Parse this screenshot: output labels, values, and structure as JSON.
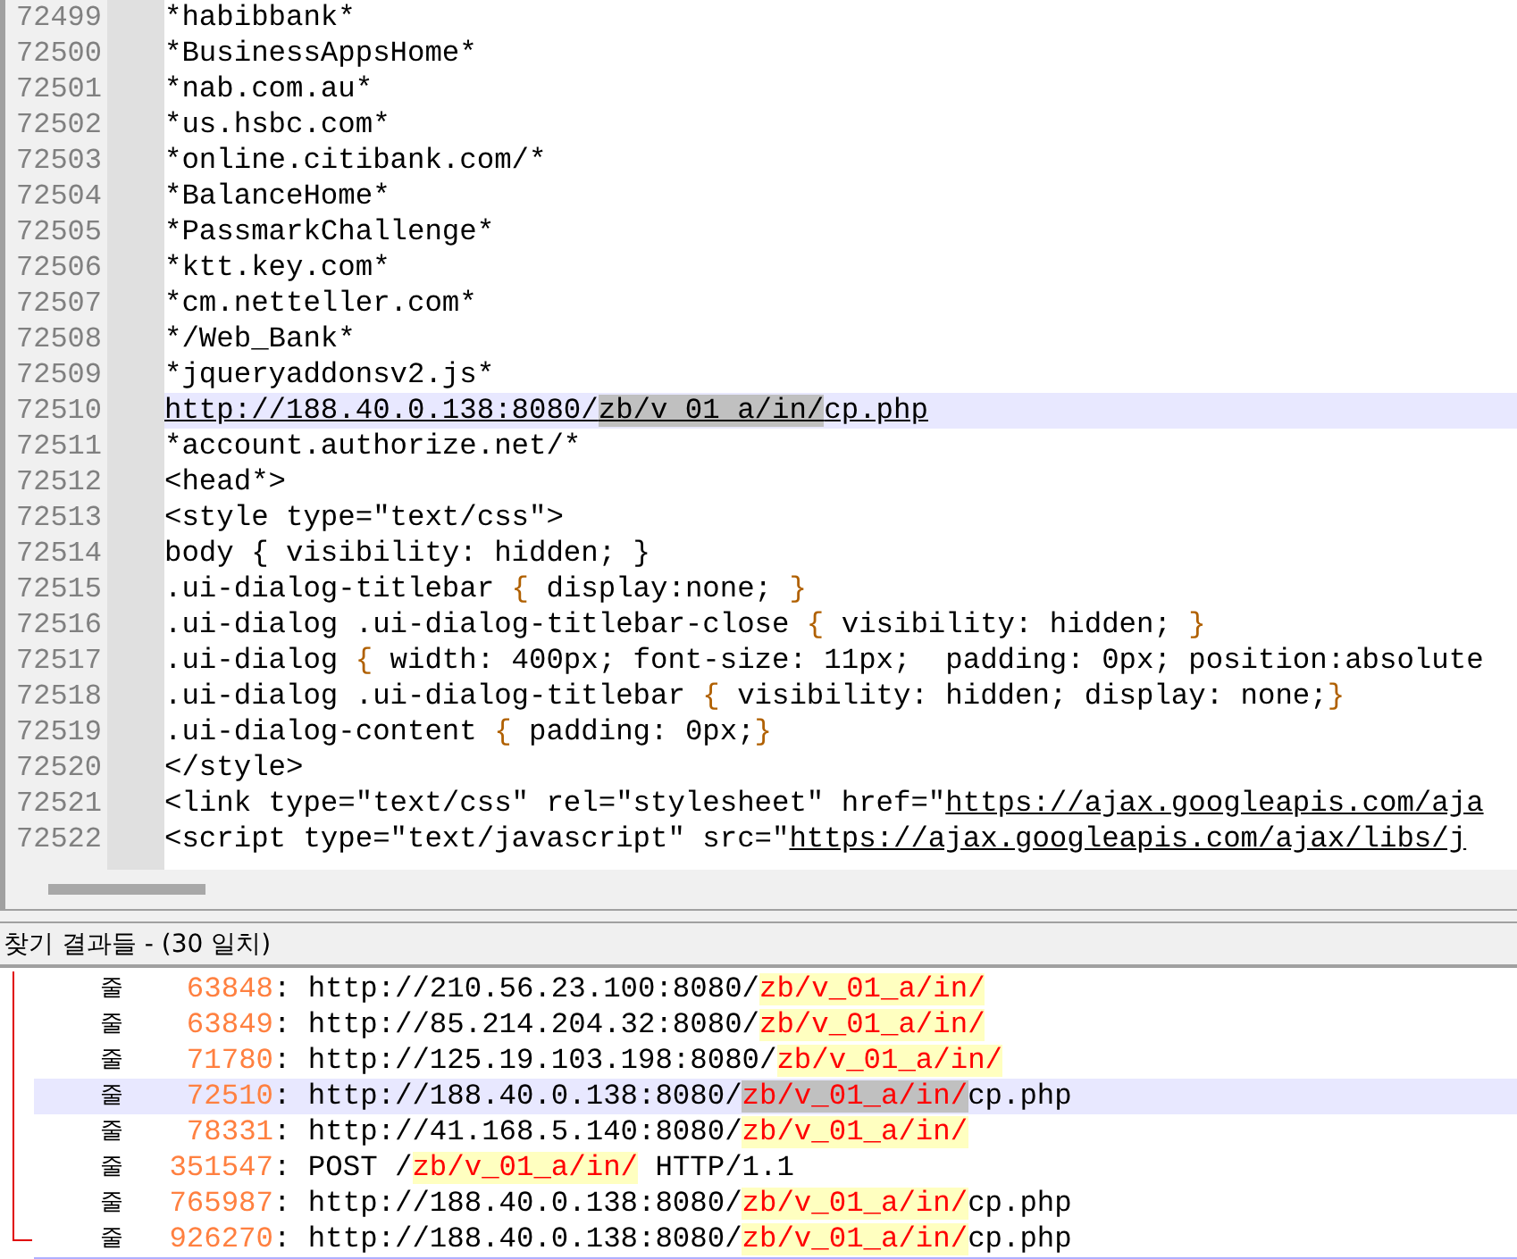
{
  "editor": {
    "lines": [
      {
        "number": "72499",
        "selected": false,
        "segments": [
          {
            "text": "*habibbank*",
            "kind": "plain"
          }
        ]
      },
      {
        "number": "72500",
        "selected": false,
        "segments": [
          {
            "text": "*BusinessAppsHome*",
            "kind": "plain"
          }
        ]
      },
      {
        "number": "72501",
        "selected": false,
        "segments": [
          {
            "text": "*nab.com.au*",
            "kind": "plain"
          }
        ]
      },
      {
        "number": "72502",
        "selected": false,
        "segments": [
          {
            "text": "*us.hsbc.com*",
            "kind": "plain"
          }
        ]
      },
      {
        "number": "72503",
        "selected": false,
        "segments": [
          {
            "text": "*online.citibank.com/*",
            "kind": "plain"
          }
        ]
      },
      {
        "number": "72504",
        "selected": false,
        "segments": [
          {
            "text": "*BalanceHome*",
            "kind": "plain"
          }
        ]
      },
      {
        "number": "72505",
        "selected": false,
        "segments": [
          {
            "text": "*PassmarkChallenge*",
            "kind": "plain"
          }
        ]
      },
      {
        "number": "72506",
        "selected": false,
        "segments": [
          {
            "text": "*ktt.key.com*",
            "kind": "plain"
          }
        ]
      },
      {
        "number": "72507",
        "selected": false,
        "segments": [
          {
            "text": "*cm.netteller.com*",
            "kind": "plain"
          }
        ]
      },
      {
        "number": "72508",
        "selected": false,
        "segments": [
          {
            "text": "*/Web_Bank*",
            "kind": "plain"
          }
        ]
      },
      {
        "number": "72509",
        "selected": false,
        "segments": [
          {
            "text": "*jqueryaddonsv2.js*",
            "kind": "plain"
          }
        ]
      },
      {
        "number": "72510",
        "selected": true,
        "segments": [
          {
            "text": "http://188.40.0.138:8080/",
            "kind": "link"
          },
          {
            "text": "zb/v_01_a/in/",
            "kind": "found"
          },
          {
            "text": "cp.php",
            "kind": "link"
          }
        ]
      },
      {
        "number": "72511",
        "selected": false,
        "segments": [
          {
            "text": "*account.authorize.net/*",
            "kind": "plain"
          }
        ]
      },
      {
        "number": "72512",
        "selected": false,
        "segments": [
          {
            "text": "<head*>",
            "kind": "plain"
          }
        ]
      },
      {
        "number": "72513",
        "selected": false,
        "segments": [
          {
            "text": "<style type=\"text/css\">",
            "kind": "plain"
          }
        ]
      },
      {
        "number": "72514",
        "selected": false,
        "segments": [
          {
            "text": "body { visibility: hidden; }",
            "kind": "plain"
          }
        ]
      },
      {
        "number": "72515",
        "selected": false,
        "segments": [
          {
            "text": ".ui-dialog-titlebar ",
            "kind": "plain"
          },
          {
            "text": "{",
            "kind": "brace"
          },
          {
            "text": " display:none; ",
            "kind": "plain"
          },
          {
            "text": "}",
            "kind": "brace"
          }
        ]
      },
      {
        "number": "72516",
        "selected": false,
        "segments": [
          {
            "text": ".ui-dialog .ui-dialog-titlebar-close ",
            "kind": "plain"
          },
          {
            "text": "{",
            "kind": "brace"
          },
          {
            "text": " visibility: hidden; ",
            "kind": "plain"
          },
          {
            "text": "}",
            "kind": "brace"
          }
        ]
      },
      {
        "number": "72517",
        "selected": false,
        "segments": [
          {
            "text": ".ui-dialog ",
            "kind": "plain"
          },
          {
            "text": "{",
            "kind": "brace"
          },
          {
            "text": " width: 400px; font-size: 11px;  padding: 0px; position:absolute",
            "kind": "plain"
          }
        ]
      },
      {
        "number": "72518",
        "selected": false,
        "segments": [
          {
            "text": ".ui-dialog .ui-dialog-titlebar ",
            "kind": "plain"
          },
          {
            "text": "{",
            "kind": "brace"
          },
          {
            "text": " visibility: hidden; display: none;",
            "kind": "plain"
          },
          {
            "text": "}",
            "kind": "brace"
          }
        ]
      },
      {
        "number": "72519",
        "selected": false,
        "segments": [
          {
            "text": ".ui-dialog-content ",
            "kind": "plain"
          },
          {
            "text": "{",
            "kind": "brace"
          },
          {
            "text": " padding: 0px;",
            "kind": "plain"
          },
          {
            "text": "}",
            "kind": "brace"
          }
        ]
      },
      {
        "number": "72520",
        "selected": false,
        "segments": [
          {
            "text": "</style>",
            "kind": "plain"
          }
        ]
      },
      {
        "number": "72521",
        "selected": false,
        "segments": [
          {
            "text": "<link type=\"text/css\" rel=\"stylesheet\" href=\"",
            "kind": "plain"
          },
          {
            "text": "https://ajax.googleapis.com/aja",
            "kind": "link"
          }
        ]
      },
      {
        "number": "72522",
        "selected": false,
        "segments": [
          {
            "text": "<script type=\"text/javascript\" src=\"",
            "kind": "plain"
          },
          {
            "text": "https://ajax.googleapis.com/ajax/libs/j",
            "kind": "link"
          }
        ]
      }
    ]
  },
  "results": {
    "title": "찾기 결과들 - (30 일치)",
    "rows": [
      {
        "label": "줄",
        "line": "63848",
        "selected": false,
        "parts": [
          {
            "text": ": http://210.56.23.100:8080/",
            "kind": "plain"
          },
          {
            "text": "zb/v_01_a/in/",
            "kind": "match"
          }
        ]
      },
      {
        "label": "줄",
        "line": "63849",
        "selected": false,
        "parts": [
          {
            "text": ": http://85.214.204.32:8080/",
            "kind": "plain"
          },
          {
            "text": "zb/v_01_a/in/",
            "kind": "match"
          }
        ]
      },
      {
        "label": "줄",
        "line": "71780",
        "selected": false,
        "parts": [
          {
            "text": ": http://125.19.103.198:8080/",
            "kind": "plain"
          },
          {
            "text": "zb/v_01_a/in/",
            "kind": "match"
          }
        ]
      },
      {
        "label": "줄",
        "line": "72510",
        "selected": true,
        "parts": [
          {
            "text": ": http://188.40.0.138:8080/",
            "kind": "plain"
          },
          {
            "text": "zb/v_01_a/in/",
            "kind": "match"
          },
          {
            "text": "cp.php",
            "kind": "plain"
          }
        ]
      },
      {
        "label": "줄",
        "line": "78331",
        "selected": false,
        "parts": [
          {
            "text": ": http://41.168.5.140:8080/",
            "kind": "plain"
          },
          {
            "text": "zb/v_01_a/in/",
            "kind": "match"
          }
        ]
      },
      {
        "label": "줄",
        "line": "351547",
        "selected": false,
        "parts": [
          {
            "text": ": POST /",
            "kind": "plain"
          },
          {
            "text": "zb/v_01_a/in/",
            "kind": "match"
          },
          {
            "text": " HTTP/1.1",
            "kind": "plain"
          }
        ]
      },
      {
        "label": "줄",
        "line": "765987",
        "selected": false,
        "parts": [
          {
            "text": ": http://188.40.0.138:8080/",
            "kind": "plain"
          },
          {
            "text": "zb/v_01_a/in/",
            "kind": "match"
          },
          {
            "text": "cp.php",
            "kind": "plain"
          }
        ]
      },
      {
        "label": "줄",
        "line": "926270",
        "selected": false,
        "parts": [
          {
            "text": ": http://188.40.0.138:8080/",
            "kind": "plain"
          },
          {
            "text": "zb/v_01_a/in/",
            "kind": "match"
          },
          {
            "text": "cp.php",
            "kind": "plain"
          }
        ]
      }
    ]
  }
}
